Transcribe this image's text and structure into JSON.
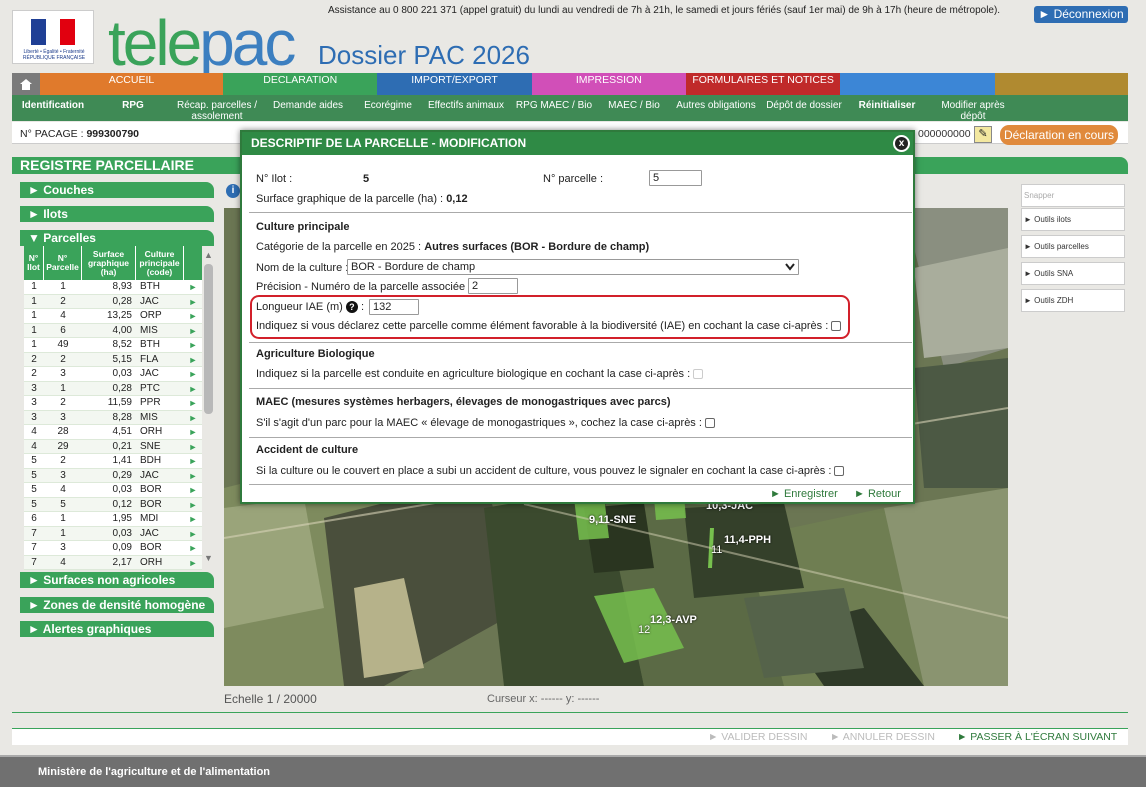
{
  "header": {
    "assistance": "Assistance au 0 800 221 371 (appel gratuit) du lundi au vendredi de 7h à 21h, le samedi et jours fériés (sauf 1er mai) de 9h à 17h (heure de métropole).",
    "deconnexion": "Déconnexion",
    "brand_part1": "tele",
    "brand_part2": "pac",
    "dossier": "Dossier PAC 2026",
    "republique": "Liberté • Égalité • Fraternité RÉPUBLIQUE FRANÇAISE"
  },
  "menu1": [
    {
      "label": "ACCUEIL",
      "color": "#e07a2c"
    },
    {
      "label": "DECLARATION",
      "color": "#3aa35a"
    },
    {
      "label": "IMPORT/EXPORT",
      "color": "#2e6db3"
    },
    {
      "label": "IMPRESSION",
      "color": "#d14fb8"
    },
    {
      "label": "FORMULAIRES ET NOTICES",
      "color": "#c02a2a"
    },
    {
      "label": "",
      "color": "#3c86d6"
    },
    {
      "label": "",
      "color": "#b08a30"
    }
  ],
  "menu2": [
    "Identification",
    "RPG",
    "Récap. parcelles / assolement",
    "Demande aides",
    "Ecorégime",
    "Effectifs animaux",
    "RPG MAEC / Bio",
    "MAEC / Bio",
    "Autres obligations",
    "Dépôt de dossier",
    "Réinitialiser",
    "Modifier après dépôt"
  ],
  "pacage": {
    "label": "N° PACAGE :",
    "value": "999300790",
    "right_text": "000000000",
    "decl_btn": "Déclaration en cours"
  },
  "registre_title": "REGISTRE PARCELLAIRE",
  "sidebar": {
    "couches": "► Couches",
    "ilots": "► Ilots",
    "parcelles": "▼ Parcelles",
    "surfaces_non_agricoles": "► Surfaces non agricoles",
    "zones_densite": "► Zones de densité homogène",
    "alertes": "► Alertes graphiques"
  },
  "parcelles_table": {
    "headers": [
      "N° Ilot",
      "N° Parcelle",
      "Surface graphique (ha)",
      "Culture principale (code)"
    ],
    "rows": [
      [
        "1",
        "1",
        "8,93",
        "BTH"
      ],
      [
        "1",
        "2",
        "0,28",
        "JAC"
      ],
      [
        "1",
        "4",
        "13,25",
        "ORP"
      ],
      [
        "1",
        "6",
        "4,00",
        "MIS"
      ],
      [
        "1",
        "49",
        "8,52",
        "BTH"
      ],
      [
        "2",
        "2",
        "5,15",
        "FLA"
      ],
      [
        "2",
        "3",
        "0,03",
        "JAC"
      ],
      [
        "3",
        "1",
        "0,28",
        "PTC"
      ],
      [
        "3",
        "2",
        "11,59",
        "PPR"
      ],
      [
        "3",
        "3",
        "8,28",
        "MIS"
      ],
      [
        "4",
        "28",
        "4,51",
        "ORH"
      ],
      [
        "4",
        "29",
        "0,21",
        "SNE"
      ],
      [
        "5",
        "2",
        "1,41",
        "BDH"
      ],
      [
        "5",
        "3",
        "0,29",
        "JAC"
      ],
      [
        "5",
        "4",
        "0,03",
        "BOR"
      ],
      [
        "5",
        "5",
        "0,12",
        "BOR"
      ],
      [
        "6",
        "1",
        "1,95",
        "MDI"
      ],
      [
        "7",
        "1",
        "0,03",
        "JAC"
      ],
      [
        "7",
        "3",
        "0,09",
        "BOR"
      ],
      [
        "7",
        "4",
        "2,17",
        "ORH"
      ]
    ]
  },
  "tools": {
    "snapper": "Snapper",
    "ilots": "► Outils ilots",
    "parcelles": "► Outils parcelles",
    "sna": "► Outils SNA",
    "zdh": "► Outils ZDH"
  },
  "map_labels": [
    "9,11-SNE",
    "10,3-JAC",
    "11,4-PPH",
    "12,3-AVP",
    "12",
    "11"
  ],
  "echelle": "Echelle 1 / 20000",
  "curseur": "Curseur x: ------ y: ------",
  "actions": {
    "valider": "► VALIDER DESSIN",
    "annuler": "► ANNULER DESSIN",
    "passer": "► PASSER À L'ÉCRAN SUIVANT"
  },
  "footer": "Ministère de l'agriculture et de l'alimentation",
  "modal": {
    "title": "DESCRIPTIF DE LA PARCELLE - MODIFICATION",
    "close": "x",
    "ilot_label": "N° Ilot :",
    "ilot_value": "5",
    "parcelle_label": "N° parcelle :",
    "parcelle_value": "5",
    "surface_label": "Surface graphique de la parcelle (ha) :",
    "surface_value": "0,12",
    "culture_section": "Culture principale",
    "categorie_label": "Catégorie de la parcelle en 2025 :",
    "categorie_value": "Autres surfaces (BOR - Bordure de champ)",
    "nom_culture_label": "Nom de la culture :",
    "nom_culture_value": "BOR - Bordure de champ",
    "precision_label": "Précision - Numéro de la parcelle associée :",
    "precision_value": "2",
    "longueur_label": "Longueur IAE (m)",
    "longueur_help": "?",
    "longueur_value": "132",
    "iae_text": "Indiquez si vous déclarez cette parcelle comme élément favorable à la biodiversité (IAE) en cochant la case ci-après :",
    "bio_section": "Agriculture Biologique",
    "bio_text": "Indiquez si la parcelle est conduite en agriculture biologique en cochant la case ci-après :",
    "maec_section": "MAEC (mesures systèmes herbagers, élevages de monogastriques avec parcs)",
    "maec_text": "S'il s'agit d'un parc pour la MAEC « élevage de monogastriques », cochez la case ci-après :",
    "accident_section": "Accident de culture",
    "accident_text": "Si la culture ou le couvert en place a subi un accident de culture, vous pouvez le signaler en cochant la case ci-après :",
    "enregistrer": "► Enregistrer",
    "retour": "► Retour"
  }
}
